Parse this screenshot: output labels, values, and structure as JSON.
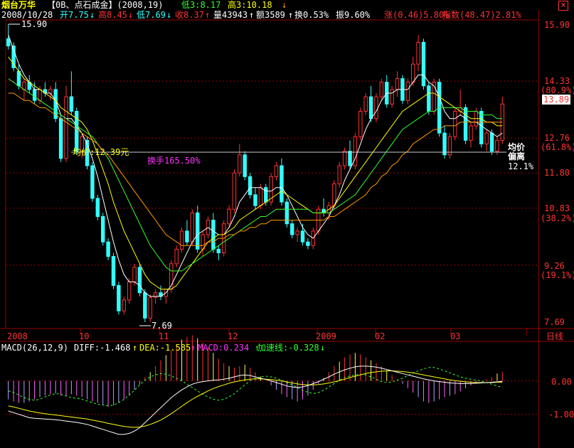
{
  "header": {
    "stock_name": "烟台万华",
    "tag": "【0B、点石成金】(2008,19)",
    "low3": "低3:8.17",
    "high3": "高3:10.18",
    "close_icon": "close-icon"
  },
  "info": {
    "date": "2008/10/28",
    "open": "开7.75",
    "high": "高8.45",
    "low": "低7.69",
    "close": "收8.37",
    "volume": "量43943",
    "amount": "额3589",
    "turnover": "换0.53%",
    "amplitude": "振9.60%",
    "change": "涨(0.46)5.80%",
    "index": "指数(48.47)2.81%"
  },
  "price_axis": {
    "labels": [
      "15.90",
      "14.33",
      "(80.9%)",
      "13.89",
      "12.76",
      "(61.8%)",
      "11.80",
      "10.83",
      "(38.2%)",
      "9.26",
      "(19.1%)",
      "7.69"
    ]
  },
  "annotations": {
    "high_marker": "15.90",
    "low_marker": "7.69",
    "avg_price": "均价:12.39元",
    "turnover_total": "换手165.50%",
    "avg_label_1": "均价",
    "avg_label_2": "偏离",
    "avg_deviation": "12.1%"
  },
  "time_axis": {
    "labels": [
      "2008",
      "10",
      "11",
      "12",
      "2009",
      "02",
      "03"
    ],
    "period_button": "日线"
  },
  "macd": {
    "title": "MACD(26,12,9)",
    "diff": "DIFF:-1.468",
    "dea": "DEA:-1.585",
    "macd": "MACD:0.234",
    "accel": "加速线:-0.328",
    "axis_labels": [
      "0.00",
      "-1.00"
    ]
  },
  "colors": {
    "up": "#ff3333",
    "down": "#33ffff",
    "ma_short": "#ffffff",
    "ma_yellow": "#ffff00",
    "ma_green": "#33ff33",
    "ma_orange": "#ff9900",
    "grid": "#990000"
  },
  "chart_data": {
    "type": "candlestick",
    "ylim": [
      7.69,
      15.9
    ],
    "candles": [
      [
        15.5,
        15.9,
        15.2,
        15.3
      ],
      [
        15.3,
        15.4,
        14.6,
        14.7
      ],
      [
        14.6,
        14.8,
        14.1,
        14.2
      ],
      [
        14.1,
        14.4,
        13.8,
        14.3
      ],
      [
        14.3,
        14.5,
        14.0,
        14.1
      ],
      [
        14.1,
        14.3,
        13.7,
        13.8
      ],
      [
        13.8,
        14.2,
        13.7,
        14.1
      ],
      [
        14.1,
        14.3,
        13.9,
        14.0
      ],
      [
        14.0,
        14.2,
        13.8,
        14.1
      ],
      [
        14.1,
        14.3,
        13.2,
        13.3
      ],
      [
        13.3,
        13.4,
        12.1,
        12.2
      ],
      [
        12.2,
        14.2,
        12.1,
        13.9
      ],
      [
        13.9,
        14.6,
        13.4,
        13.5
      ],
      [
        13.5,
        13.6,
        12.3,
        12.4
      ],
      [
        12.4,
        12.9,
        12.2,
        12.8
      ],
      [
        12.7,
        12.8,
        11.9,
        12.0
      ],
      [
        12.0,
        12.1,
        11.0,
        11.1
      ],
      [
        11.1,
        11.2,
        10.5,
        10.6
      ],
      [
        10.6,
        10.7,
        9.8,
        9.9
      ],
      [
        9.9,
        10.0,
        9.4,
        9.5
      ],
      [
        9.5,
        9.6,
        8.6,
        8.7
      ],
      [
        8.7,
        8.8,
        7.9,
        8.0
      ],
      [
        8.0,
        8.4,
        7.9,
        8.3
      ],
      [
        8.3,
        8.9,
        8.2,
        8.8
      ],
      [
        8.8,
        9.3,
        8.7,
        9.2
      ],
      [
        9.2,
        9.3,
        8.4,
        8.5
      ],
      [
        8.5,
        8.6,
        7.69,
        7.8
      ],
      [
        7.8,
        8.45,
        7.69,
        8.37
      ],
      [
        8.37,
        8.6,
        8.2,
        8.5
      ],
      [
        8.5,
        8.7,
        8.3,
        8.4
      ],
      [
        8.4,
        8.6,
        8.2,
        8.6
      ],
      [
        8.6,
        9.4,
        8.5,
        9.3
      ],
      [
        9.3,
        9.8,
        9.2,
        9.7
      ],
      [
        9.7,
        10.3,
        9.6,
        10.2
      ],
      [
        10.2,
        10.5,
        9.8,
        9.9
      ],
      [
        9.9,
        10.8,
        9.8,
        10.7
      ],
      [
        10.7,
        10.9,
        9.6,
        9.7
      ],
      [
        9.7,
        10.2,
        9.5,
        10.1
      ],
      [
        10.1,
        10.6,
        10.0,
        10.5
      ],
      [
        10.5,
        10.7,
        9.6,
        9.7
      ],
      [
        9.7,
        9.8,
        9.4,
        9.6
      ],
      [
        9.6,
        10.5,
        9.5,
        10.4
      ],
      [
        10.4,
        10.9,
        10.3,
        10.8
      ],
      [
        10.8,
        11.9,
        10.7,
        11.8
      ],
      [
        11.8,
        12.6,
        11.7,
        12.3
      ],
      [
        12.3,
        12.4,
        11.6,
        11.7
      ],
      [
        11.7,
        11.8,
        11.1,
        11.2
      ],
      [
        11.2,
        11.4,
        10.8,
        10.9
      ],
      [
        10.9,
        11.5,
        10.8,
        11.4
      ],
      [
        11.4,
        11.5,
        10.9,
        11.0
      ],
      [
        11.0,
        11.8,
        10.9,
        11.7
      ],
      [
        11.7,
        12.1,
        11.6,
        12.0
      ],
      [
        12.0,
        12.2,
        10.9,
        11.0
      ],
      [
        11.0,
        11.1,
        10.3,
        10.4
      ],
      [
        10.4,
        10.5,
        10.0,
        10.1
      ],
      [
        10.1,
        10.3,
        9.9,
        10.2
      ],
      [
        10.2,
        10.4,
        9.8,
        9.9
      ],
      [
        9.9,
        10.0,
        9.7,
        9.8
      ],
      [
        9.8,
        10.3,
        9.7,
        10.2
      ],
      [
        10.2,
        10.9,
        10.1,
        10.8
      ],
      [
        10.8,
        11.1,
        10.6,
        10.7
      ],
      [
        10.7,
        11.0,
        10.5,
        10.9
      ],
      [
        10.9,
        11.6,
        10.8,
        11.5
      ],
      [
        11.5,
        12.1,
        11.4,
        12.0
      ],
      [
        12.0,
        12.5,
        11.9,
        12.4
      ],
      [
        12.4,
        12.7,
        11.9,
        12.0
      ],
      [
        12.0,
        12.9,
        11.9,
        12.8
      ],
      [
        12.8,
        13.6,
        12.7,
        13.5
      ],
      [
        13.5,
        14.0,
        13.4,
        13.9
      ],
      [
        13.9,
        14.2,
        13.2,
        13.3
      ],
      [
        13.3,
        14.0,
        13.2,
        13.9
      ],
      [
        13.9,
        14.4,
        13.8,
        14.3
      ],
      [
        14.3,
        14.5,
        13.6,
        13.7
      ],
      [
        13.7,
        14.2,
        13.6,
        14.1
      ],
      [
        14.1,
        14.6,
        13.9,
        14.4
      ],
      [
        14.4,
        14.5,
        13.7,
        13.8
      ],
      [
        13.8,
        14.4,
        13.7,
        14.3
      ],
      [
        14.3,
        15.0,
        14.2,
        14.8
      ],
      [
        14.8,
        15.6,
        14.6,
        15.4
      ],
      [
        15.4,
        15.5,
        14.1,
        14.2
      ],
      [
        14.2,
        14.3,
        13.4,
        13.5
      ],
      [
        13.5,
        14.4,
        13.4,
        14.3
      ],
      [
        14.3,
        14.4,
        12.8,
        12.9
      ],
      [
        12.9,
        13.1,
        12.2,
        12.3
      ],
      [
        12.3,
        12.9,
        12.2,
        12.8
      ],
      [
        12.8,
        13.6,
        12.7,
        13.5
      ],
      [
        13.5,
        14.1,
        13.4,
        13.6
      ],
      [
        13.6,
        13.7,
        12.6,
        12.7
      ],
      [
        12.7,
        13.2,
        12.5,
        13.1
      ],
      [
        13.1,
        13.6,
        13.0,
        13.5
      ],
      [
        13.5,
        13.6,
        12.5,
        12.6
      ],
      [
        12.6,
        13.0,
        12.4,
        12.9
      ],
      [
        12.9,
        13.0,
        12.3,
        12.4
      ],
      [
        12.4,
        12.8,
        12.3,
        12.7
      ],
      [
        12.7,
        13.9,
        12.6,
        13.7
      ]
    ],
    "series": [
      {
        "values": [
          15.6,
          15.2,
          14.8,
          14.5,
          14.3,
          14.1,
          14.1,
          14.0,
          14.0,
          13.8,
          13.4,
          13.3,
          13.3,
          13.1,
          12.9,
          12.6,
          12.2,
          11.7,
          11.1,
          10.5,
          9.9,
          9.4,
          9.0,
          8.8,
          8.8,
          8.7,
          8.5,
          8.4,
          8.4,
          8.4,
          8.5,
          8.7,
          9.0,
          9.3,
          9.6,
          9.9,
          10.1,
          10.2,
          10.3,
          10.2,
          10.1,
          10.1,
          10.3,
          10.6,
          11.0,
          11.2,
          11.4,
          11.4,
          11.4,
          11.3,
          11.3,
          11.4,
          11.4,
          11.2,
          10.9,
          10.6,
          10.3,
          10.1,
          10.0,
          10.2,
          10.4,
          10.6,
          10.9,
          11.2,
          11.6,
          11.9,
          12.2,
          12.6,
          13.0,
          13.3,
          13.5,
          13.8,
          14.0,
          14.0,
          14.1,
          14.1,
          14.1,
          14.3,
          14.5,
          14.5,
          14.3,
          14.2,
          13.9,
          13.5,
          13.3,
          13.3,
          13.4,
          13.3,
          13.2,
          13.2,
          13.1,
          13.0,
          12.9,
          12.8,
          12.9
        ]
      },
      {
        "values": [
          15.0,
          14.8,
          14.6,
          14.4,
          14.3,
          14.2,
          14.1,
          14.0,
          13.9,
          13.8,
          13.6,
          13.5,
          13.4,
          13.3,
          13.2,
          13.0,
          12.7,
          12.3,
          11.9,
          11.5,
          11.0,
          10.6,
          10.2,
          9.9,
          9.6,
          9.3,
          9.0,
          8.8,
          8.7,
          8.6,
          8.6,
          8.6,
          8.7,
          8.9,
          9.1,
          9.3,
          9.5,
          9.7,
          9.9,
          10.0,
          10.1,
          10.1,
          10.2,
          10.3,
          10.5,
          10.6,
          10.7,
          10.8,
          10.9,
          11.0,
          11.1,
          11.2,
          11.3,
          11.2,
          11.1,
          11.0,
          10.9,
          10.8,
          10.7,
          10.7,
          10.7,
          10.8,
          10.9,
          11.1,
          11.3,
          11.5,
          11.7,
          11.9,
          12.1,
          12.3,
          12.5,
          12.7,
          12.9,
          13.1,
          13.3,
          13.5,
          13.6,
          13.7,
          13.8,
          13.9,
          14.0,
          14.0,
          13.9,
          13.8,
          13.7,
          13.6,
          13.5,
          13.4,
          13.3,
          13.3,
          13.3,
          13.2,
          13.2,
          13.1,
          13.1
        ]
      },
      {
        "values": [
          14.4,
          14.3,
          14.2,
          14.1,
          14.0,
          13.9,
          13.8,
          13.7,
          13.6,
          13.5,
          13.4,
          13.3,
          13.2,
          13.1,
          13.0,
          12.9,
          12.8,
          12.6,
          12.4,
          12.2,
          11.9,
          11.6,
          11.3,
          11.0,
          10.7,
          10.4,
          10.1,
          9.8,
          9.6,
          9.4,
          9.2,
          9.1,
          9.1,
          9.1,
          9.2,
          9.3,
          9.4,
          9.5,
          9.6,
          9.7,
          9.8,
          9.9,
          10.0,
          10.1,
          10.2,
          10.3,
          10.4,
          10.5,
          10.6,
          10.6,
          10.7,
          10.8,
          10.8,
          10.8,
          10.8,
          10.8,
          10.8,
          10.8,
          10.7,
          10.7,
          10.7,
          10.7,
          10.8,
          10.9,
          11.0,
          11.1,
          11.2,
          11.4,
          11.6,
          11.8,
          12.0,
          12.2,
          12.4,
          12.6,
          12.8,
          13.0,
          13.1,
          13.2,
          13.3,
          13.4,
          13.5,
          13.5,
          13.6,
          13.6,
          13.6,
          13.6,
          13.6,
          13.5,
          13.5,
          13.5,
          13.4,
          13.4,
          13.4,
          13.3,
          13.3
        ]
      },
      {
        "values": [
          14.0,
          14.0,
          13.9,
          13.8,
          13.8,
          13.7,
          13.6,
          13.6,
          13.5,
          13.4,
          13.3,
          13.2,
          13.1,
          13.0,
          12.9,
          12.8,
          12.7,
          12.6,
          12.4,
          12.3,
          12.1,
          11.9,
          11.7,
          11.5,
          11.3,
          11.1,
          10.9,
          10.7,
          10.5,
          10.3,
          10.1,
          10.0,
          9.9,
          9.8,
          9.8,
          9.8,
          9.8,
          9.8,
          9.9,
          9.9,
          10.0,
          10.0,
          10.1,
          10.1,
          10.2,
          10.2,
          10.3,
          10.3,
          10.4,
          10.4,
          10.5,
          10.5,
          10.5,
          10.5,
          10.5,
          10.5,
          10.5,
          10.5,
          10.5,
          10.5,
          10.5,
          10.6,
          10.6,
          10.7,
          10.8,
          10.9,
          11.0,
          11.1,
          11.2,
          11.4,
          11.5,
          11.7,
          11.8,
          12.0,
          12.1,
          12.3,
          12.4,
          12.6,
          12.7,
          12.8,
          12.9,
          13.0,
          13.0,
          13.1,
          13.1,
          13.1,
          13.2,
          13.2,
          13.2,
          13.2,
          13.2,
          13.2,
          13.2,
          13.2,
          13.2
        ]
      }
    ],
    "macd_hist": [
      -0.25,
      -0.28,
      -0.3,
      -0.3,
      -0.28,
      -0.25,
      -0.22,
      -0.2,
      -0.18,
      -0.17,
      -0.2,
      -0.2,
      -0.18,
      -0.2,
      -0.22,
      -0.25,
      -0.28,
      -0.3,
      -0.32,
      -0.35,
      -0.33,
      -0.3,
      -0.25,
      -0.2,
      -0.12,
      -0.05,
      0.05,
      0.12,
      0.2,
      0.28,
      0.35,
      0.42,
      0.5,
      0.56,
      0.6,
      0.62,
      0.58,
      0.52,
      0.45,
      0.38,
      0.3,
      0.24,
      0.2,
      0.18,
      0.2,
      0.22,
      0.18,
      0.12,
      0.06,
      0.0,
      -0.06,
      -0.12,
      -0.18,
      -0.22,
      -0.25,
      -0.28,
      -0.25,
      -0.2,
      -0.12,
      -0.04,
      0.04,
      0.12,
      0.2,
      0.26,
      0.32,
      0.36,
      0.38,
      0.36,
      0.32,
      0.28,
      0.24,
      0.2,
      0.14,
      0.08,
      0.02,
      -0.04,
      -0.1,
      -0.16,
      -0.22,
      -0.28,
      -0.3,
      -0.28,
      -0.25,
      -0.22,
      -0.2,
      -0.18,
      -0.14,
      -0.1,
      -0.06,
      -0.02,
      0.0,
      0.02,
      0.05,
      0.1,
      0.12
    ],
    "diff": [
      -0.9,
      -0.95,
      -1.0,
      -1.05,
      -1.1,
      -1.12,
      -1.13,
      -1.14,
      -1.15,
      -1.16,
      -1.18,
      -1.2,
      -1.22,
      -1.24,
      -1.27,
      -1.3,
      -1.35,
      -1.4,
      -1.45,
      -1.5,
      -1.55,
      -1.6,
      -1.6,
      -1.57,
      -1.5,
      -1.4,
      -1.25,
      -1.1,
      -0.95,
      -0.8,
      -0.65,
      -0.5,
      -0.38,
      -0.27,
      -0.18,
      -0.1,
      -0.05,
      -0.02,
      0.0,
      0.02,
      0.03,
      0.05,
      0.08,
      0.12,
      0.16,
      0.18,
      0.16,
      0.12,
      0.08,
      0.04,
      0.0,
      -0.05,
      -0.1,
      -0.15,
      -0.18,
      -0.2,
      -0.18,
      -0.14,
      -0.08,
      -0.02,
      0.05,
      0.12,
      0.2,
      0.27,
      0.33,
      0.38,
      0.42,
      0.44,
      0.44,
      0.43,
      0.41,
      0.38,
      0.34,
      0.3,
      0.26,
      0.22,
      0.18,
      0.14,
      0.1,
      0.06,
      0.03,
      0.0,
      -0.02,
      -0.04,
      -0.06,
      -0.07,
      -0.08,
      -0.08,
      -0.08,
      -0.07,
      -0.06,
      -0.05,
      -0.04,
      -0.03,
      -0.01
    ],
    "dea": [
      -0.75,
      -0.78,
      -0.82,
      -0.86,
      -0.9,
      -0.93,
      -0.96,
      -0.98,
      -1.0,
      -1.02,
      -1.04,
      -1.06,
      -1.08,
      -1.1,
      -1.12,
      -1.14,
      -1.17,
      -1.2,
      -1.23,
      -1.27,
      -1.3,
      -1.33,
      -1.36,
      -1.38,
      -1.39,
      -1.38,
      -1.35,
      -1.3,
      -1.24,
      -1.17,
      -1.08,
      -0.98,
      -0.87,
      -0.76,
      -0.65,
      -0.55,
      -0.46,
      -0.38,
      -0.3,
      -0.23,
      -0.17,
      -0.12,
      -0.07,
      -0.03,
      0.0,
      0.03,
      0.05,
      0.06,
      0.06,
      0.05,
      0.04,
      0.02,
      0.0,
      -0.03,
      -0.06,
      -0.09,
      -0.11,
      -0.12,
      -0.12,
      -0.11,
      -0.09,
      -0.06,
      -0.03,
      0.01,
      0.05,
      0.1,
      0.14,
      0.18,
      0.22,
      0.25,
      0.27,
      0.29,
      0.3,
      0.3,
      0.29,
      0.28,
      0.26,
      0.24,
      0.21,
      0.18,
      0.15,
      0.12,
      0.09,
      0.06,
      0.03,
      0.01,
      -0.01,
      -0.03,
      -0.04,
      -0.05,
      -0.05,
      -0.05,
      -0.05,
      -0.04,
      -0.04
    ],
    "accel": [
      -0.3,
      -0.35,
      -0.42,
      -0.5,
      -0.55,
      -0.58,
      -0.55,
      -0.48,
      -0.42,
      -0.38,
      -0.4,
      -0.45,
      -0.5,
      -0.52,
      -0.55,
      -0.6,
      -0.65,
      -0.7,
      -0.72,
      -0.75,
      -0.72,
      -0.65,
      -0.55,
      -0.42,
      -0.28,
      -0.12,
      0.02,
      0.12,
      0.18,
      0.22,
      0.2,
      0.15,
      0.08,
      0.0,
      -0.1,
      -0.2,
      -0.3,
      -0.4,
      -0.48,
      -0.55,
      -0.58,
      -0.55,
      -0.48,
      -0.38,
      -0.25,
      -0.12,
      0.0,
      0.08,
      0.12,
      0.14,
      0.12,
      0.08,
      0.02,
      -0.05,
      -0.12,
      -0.2,
      -0.28,
      -0.34,
      -0.38,
      -0.35,
      -0.28,
      -0.18,
      -0.08,
      0.02,
      0.1,
      0.15,
      0.18,
      0.2,
      0.18,
      0.12,
      0.05,
      -0.02,
      -0.05,
      -0.03,
      0.02,
      0.08,
      0.16,
      0.24,
      0.3,
      0.36,
      0.4,
      0.4,
      0.36,
      0.3,
      0.24,
      0.18,
      0.12,
      0.08,
      0.05,
      0.02,
      0.0,
      -0.05,
      -0.1,
      -0.15,
      -0.2
    ]
  }
}
